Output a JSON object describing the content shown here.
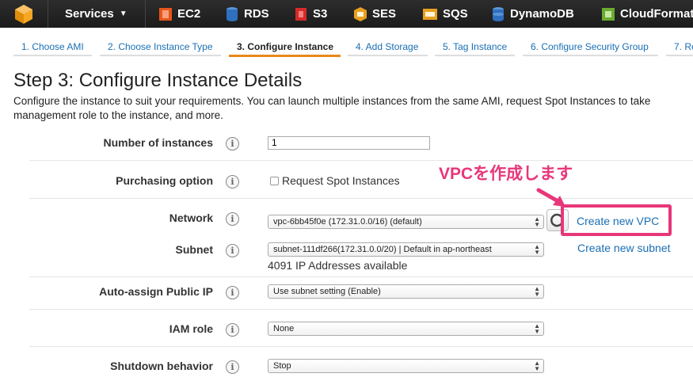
{
  "topnav": {
    "items": [
      {
        "label": "Services",
        "icon": "services-caret"
      },
      {
        "label": "EC2",
        "icon": "ec2-icon",
        "color": "#e8551b"
      },
      {
        "label": "RDS",
        "icon": "rds-icon",
        "color": "#2f6fbf"
      },
      {
        "label": "S3",
        "icon": "s3-icon",
        "color": "#d62a2a"
      },
      {
        "label": "SES",
        "icon": "ses-icon",
        "color": "#e8a020"
      },
      {
        "label": "SQS",
        "icon": "sqs-icon",
        "color": "#e8a020"
      },
      {
        "label": "DynamoDB",
        "icon": "dynamodb-icon",
        "color": "#2f6fbf"
      },
      {
        "label": "CloudFormat",
        "icon": "cloudformation-icon",
        "color": "#6aab2f"
      }
    ]
  },
  "steps": [
    "1. Choose AMI",
    "2. Choose Instance Type",
    "3. Configure Instance",
    "4. Add Storage",
    "5. Tag Instance",
    "6. Configure Security Group",
    "7. Re"
  ],
  "page": {
    "title": "Step 3: Configure Instance Details",
    "description_line1": "Configure the instance to suit your requirements. You can launch multiple instances from the same AMI, request Spot Instances to take",
    "description_line2": "management role to the instance, and more."
  },
  "form": {
    "instances_label": "Number of instances",
    "instances_value": "1",
    "purchasing_label": "Purchasing option",
    "spot_label": "Request Spot Instances",
    "network_label": "Network",
    "network_value": "vpc-6bb45f0e (172.31.0.0/16) (default)",
    "create_vpc_link": "Create new VPC",
    "subnet_label": "Subnet",
    "subnet_value": "subnet-111df266(172.31.0.0/20) | Default in ap-northeast",
    "subnet_available": "4091 IP Addresses available",
    "create_subnet_link": "Create new subnet",
    "public_ip_label": "Auto-assign Public IP",
    "public_ip_value": "Use subnet setting (Enable)",
    "iam_label": "IAM role",
    "iam_value": "None",
    "shutdown_label": "Shutdown behavior",
    "shutdown_value": "Stop",
    "info_glyph": "i"
  },
  "annotation": {
    "text": "VPCを作成します",
    "color": "#e8367a"
  },
  "colors": {
    "accent": "#e8891b",
    "link": "#1a6fb4"
  }
}
